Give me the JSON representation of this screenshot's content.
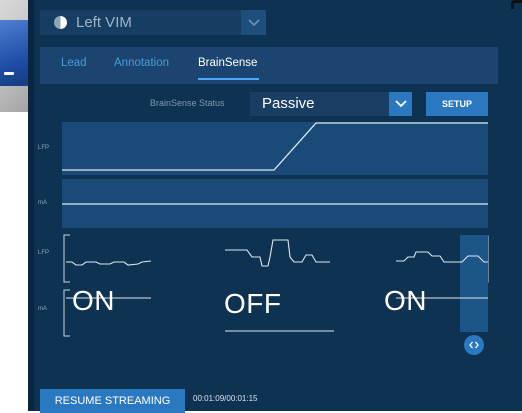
{
  "header": {
    "lead_name": "Left VIM"
  },
  "tabs": [
    {
      "label": "Lead",
      "active": false
    },
    {
      "label": "Annotation",
      "active": false
    },
    {
      "label": "BrainSense",
      "active": true
    }
  ],
  "status": {
    "label": "BrainSense Status",
    "value": "Passive",
    "setup_label": "SETUP"
  },
  "rows": {
    "lfp_label": "LFP",
    "ma_label": "mA"
  },
  "overlay_labels": {
    "left": "ON",
    "middle": "OFF",
    "right": "ON"
  },
  "footer": {
    "resume_label": "RESUME STREAMING",
    "timer": "00:01:09/00:01:15"
  },
  "colors": {
    "background": "#0e3252",
    "accent": "#2a78c0",
    "tab_active": "#ffffff",
    "tab_inactive": "#4a9bd6"
  },
  "icons": {
    "lead": "half-circle-icon",
    "dropdown": "chevron-down-icon",
    "scroll_handle": "left-right-arrows-icon"
  }
}
